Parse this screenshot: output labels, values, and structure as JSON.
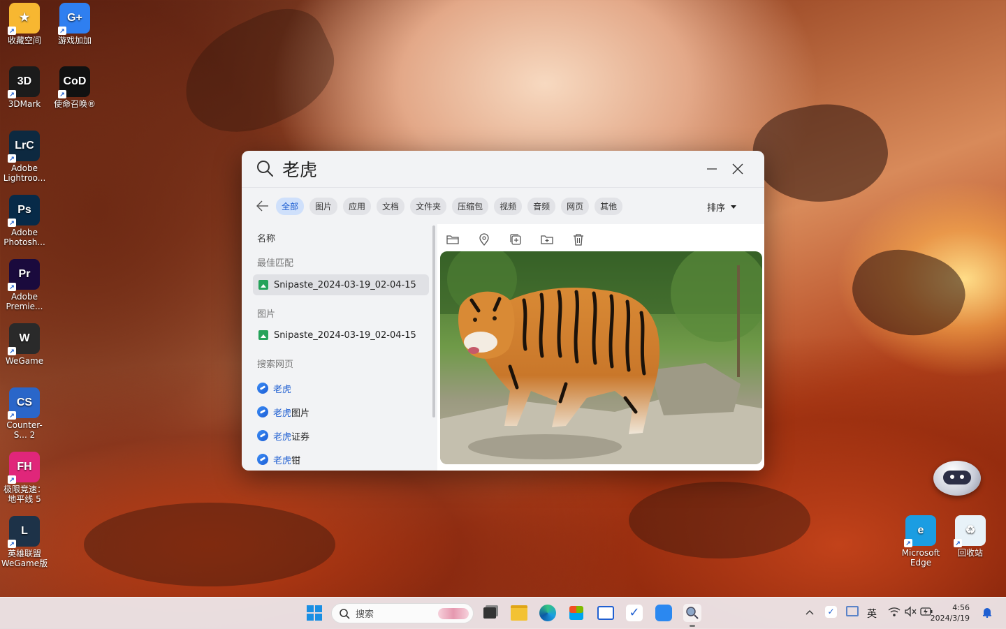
{
  "desktop": {
    "icons_left": [
      {
        "label": "收藏空间",
        "color": "#f7b731",
        "glyph": "★"
      },
      {
        "label": "游戏加加",
        "color": "#2f7ff0",
        "glyph": "G+"
      },
      {
        "label": "3DMark",
        "color": "#1b1b1b",
        "glyph": "3D"
      },
      {
        "label": "使命召唤®",
        "color": "#111111",
        "glyph": "CoD"
      },
      {
        "label": "Adobe Lightroo...",
        "color": "#0d2940",
        "glyph": "LrC"
      },
      {
        "label": "Adobe Photosh...",
        "color": "#072a48",
        "glyph": "Ps"
      },
      {
        "label": "Adobe Premie...",
        "color": "#1a0a3d",
        "glyph": "Pr"
      },
      {
        "label": "WeGame",
        "color": "#2a2a2a",
        "glyph": "W"
      },
      {
        "label": "Counter-S... 2",
        "color": "#2a66c9",
        "glyph": "CS"
      },
      {
        "label": "极限竞速：地平线 5",
        "color": "#e0267a",
        "glyph": "FH"
      },
      {
        "label": "英雄联盟WeGame版",
        "color": "#1d3248",
        "glyph": "L"
      }
    ],
    "icons_right": [
      {
        "label": "Microsoft Edge",
        "color": "#1b9de2",
        "glyph": "e"
      },
      {
        "label": "回收站",
        "color": "#e8f2f8",
        "glyph": "♻"
      }
    ]
  },
  "search_window": {
    "query": "老虎",
    "minimize_icon": "minimize-icon",
    "close_icon": "close-icon",
    "filters": [
      "全部",
      "图片",
      "应用",
      "文档",
      "文件夹",
      "压缩包",
      "视频",
      "音频",
      "网页",
      "其他"
    ],
    "active_filter": "全部",
    "sort_label": "排序",
    "column_header": "名称",
    "sections": {
      "best_match": "最佳匹配",
      "images": "图片",
      "web": "搜索网页"
    },
    "best_match_item": "Snipaste_2024-03-19_02-04-15",
    "image_item": "Snipaste_2024-03-19_02-04-15",
    "web_items": [
      {
        "hl": "老虎",
        "rest": ""
      },
      {
        "hl": "老虎",
        "rest": "图片"
      },
      {
        "hl": "老虎",
        "rest": "证券"
      },
      {
        "hl": "老虎",
        "rest": "钳"
      }
    ],
    "preview_tools": [
      "folder-icon",
      "location-icon",
      "copy-icon",
      "move-icon",
      "delete-icon"
    ]
  },
  "taskbar": {
    "search_placeholder": "搜索",
    "ime": "英",
    "time": "4:56",
    "date": "2024/3/19"
  }
}
